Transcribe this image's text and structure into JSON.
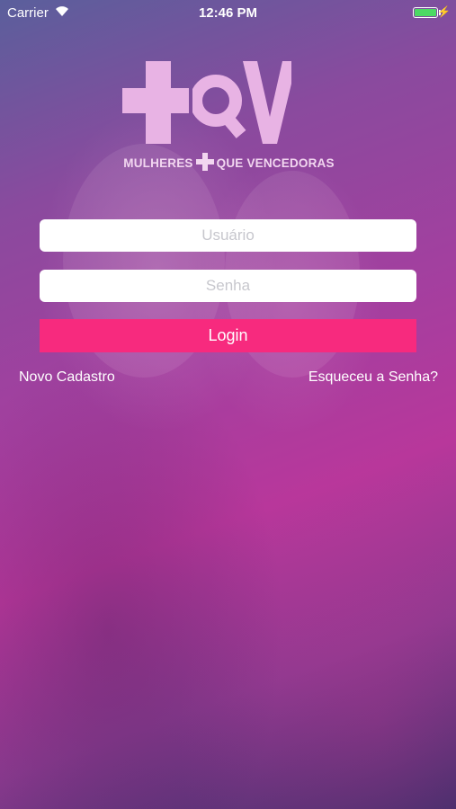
{
  "status_bar": {
    "carrier": "Carrier",
    "time": "12:46 PM",
    "wifi_icon": "wifi-icon",
    "battery_icon": "battery-icon",
    "battery_color": "#4cd964"
  },
  "logo": {
    "text": "+QV",
    "tagline_left": "MULHERES",
    "tagline_right": "QUE VENCEDORAS",
    "color": "#e8b3e4"
  },
  "form": {
    "username_placeholder": "Usuário",
    "password_placeholder": "Senha",
    "login_label": "Login",
    "login_color": "#f72a7e"
  },
  "links": {
    "new_account": "Novo Cadastro",
    "forgot_password": "Esqueceu a Senha?"
  }
}
